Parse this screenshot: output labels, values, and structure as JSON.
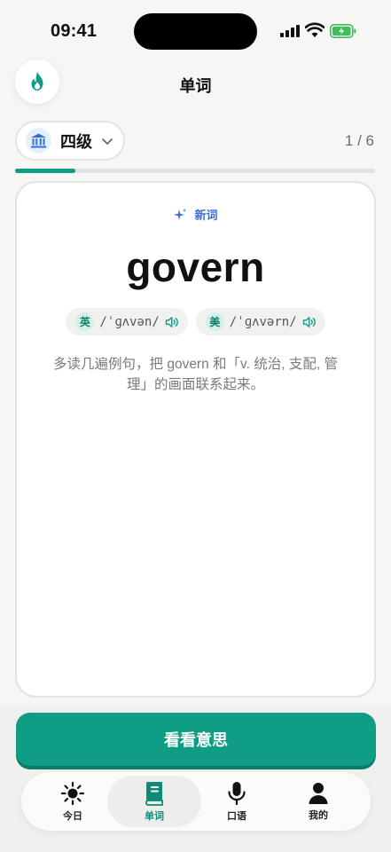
{
  "status": {
    "time": "09:41"
  },
  "header": {
    "title": "单词",
    "logo_icon": "flame-icon"
  },
  "level": {
    "label": "四级",
    "icon": "bank-icon"
  },
  "counter": "1 / 6",
  "progress": {
    "fraction": 0.167,
    "color": "#0f9d86"
  },
  "card": {
    "tag": "新词",
    "word": "govern",
    "phonetics": [
      {
        "badge": "英",
        "ipa": "/ˈɡʌvən/"
      },
      {
        "badge": "美",
        "ipa": "/ˈɡʌvərn/"
      }
    ],
    "hint": "多读几遍例句，把 govern 和「v. 统治, 支配, 管理」的画面联系起来。"
  },
  "actions": {
    "primary": "看看意思"
  },
  "tabs": [
    {
      "label": "今日",
      "icon": "sun-icon",
      "active": false
    },
    {
      "label": "单词",
      "icon": "book-icon",
      "active": true
    },
    {
      "label": "口语",
      "icon": "mic-icon",
      "active": false
    },
    {
      "label": "我的",
      "icon": "person-icon",
      "active": false
    }
  ],
  "colors": {
    "accent": "#0f9d86",
    "tag_blue": "#3b6fd8"
  }
}
